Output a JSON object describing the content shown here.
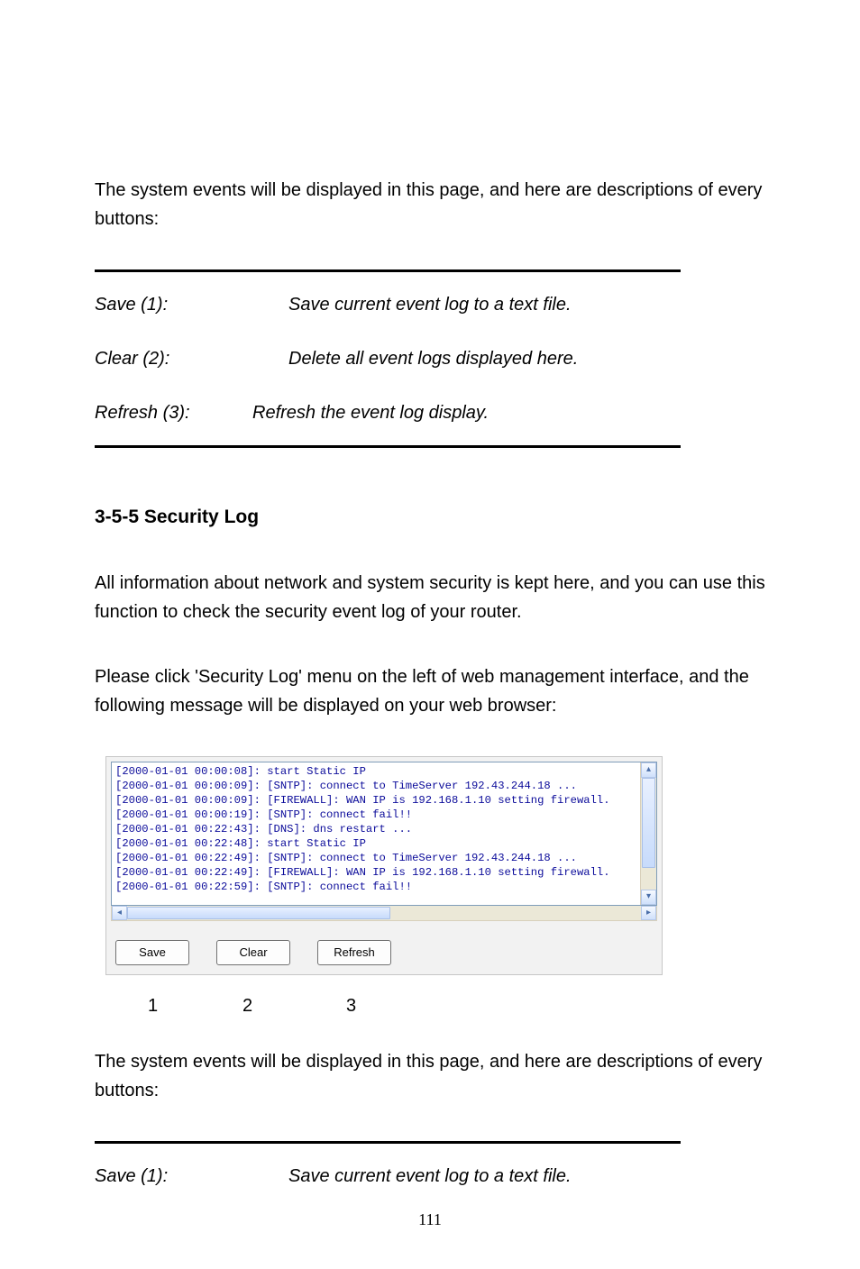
{
  "intro1": "The system events will be displayed in this page, and here are descriptions of every buttons:",
  "table1": {
    "rows": [
      {
        "label": "Save (1):",
        "desc": "Save current event log to a text file."
      },
      {
        "label": "Clear (2):",
        "desc": "Delete all event logs displayed here."
      },
      {
        "label": "Refresh (3):",
        "desc": "Refresh the event log display."
      }
    ]
  },
  "section_heading": "3-5-5 Security Log",
  "para_a": "All information about network and system security is kept here, and you can use this function to check the security event log of your router.",
  "para_b": "Please click 'Security Log' menu on the left of web management interface, and the following message will be displayed on your web browser:",
  "log_lines": [
    "[2000-01-01 00:00:08]: start Static IP",
    "[2000-01-01 00:00:09]: [SNTP]: connect to TimeServer 192.43.244.18 ...",
    "[2000-01-01 00:00:09]: [FIREWALL]: WAN IP is 192.168.1.10 setting firewall.",
    "[2000-01-01 00:00:19]: [SNTP]: connect fail!!",
    "[2000-01-01 00:22:43]: [DNS]: dns restart ...",
    "[2000-01-01 00:22:48]: start Static IP",
    "[2000-01-01 00:22:49]: [SNTP]: connect to TimeServer 192.43.244.18 ...",
    "[2000-01-01 00:22:49]: [FIREWALL]: WAN IP is 192.168.1.10 setting firewall.",
    "[2000-01-01 00:22:59]: [SNTP]: connect fail!!"
  ],
  "buttons": {
    "save": "Save",
    "clear": "Clear",
    "refresh": "Refresh"
  },
  "button_numbers": {
    "n1": "1",
    "n2": "2",
    "n3": "3"
  },
  "intro2": "The system events will be displayed in this page, and here are descriptions of every buttons:",
  "table2": {
    "rows": [
      {
        "label": "Save (1):",
        "desc": "Save current event log to a text file."
      }
    ]
  },
  "page_number": "111"
}
